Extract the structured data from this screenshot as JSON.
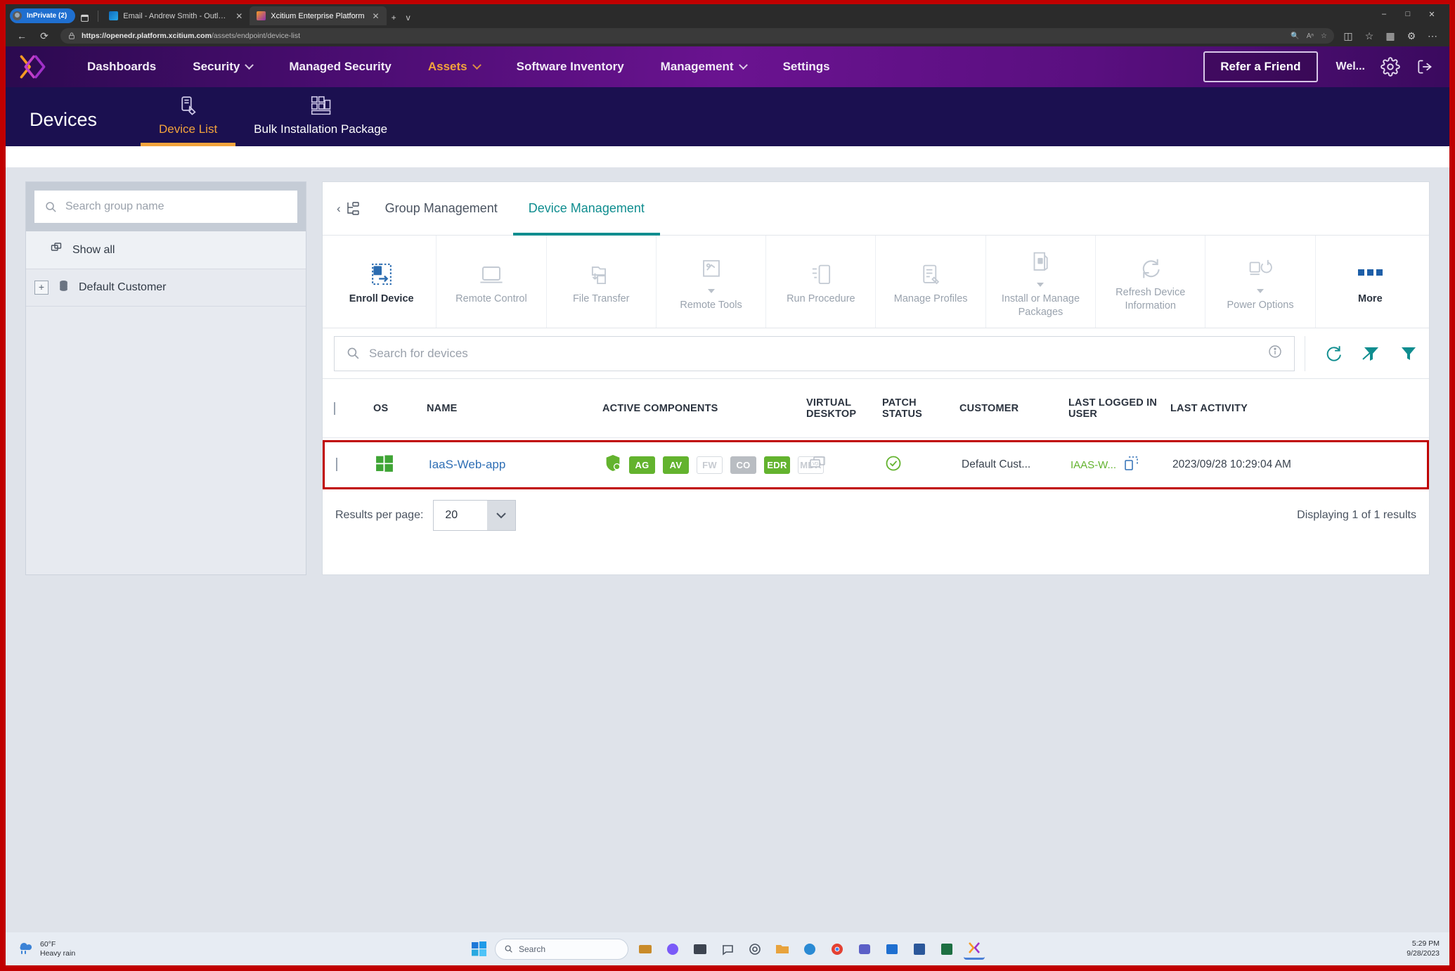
{
  "browser": {
    "tabs": [
      {
        "label": "InPrivate (2)",
        "icon": "inprivate-icon",
        "active": false
      },
      {
        "label": "Email - Andrew Smith - Outlook",
        "icon": "outlook-favicon",
        "active": false
      },
      {
        "label": "Xcitium Enterprise Platform",
        "icon": "xcitium-favicon",
        "active": true
      }
    ],
    "new_tab_label": "+",
    "tab_list_label": "v",
    "window_controls": {
      "minimize": "–",
      "maximize": "□",
      "close": "✕"
    },
    "back_label": "←",
    "refresh_label": "⟳",
    "url_bold": "https://openedr.platform.xcitium.com",
    "url_rest": "/assets/endpoint/device-list",
    "omni_icons": [
      "zoom-icon",
      "read-aloud-icon",
      "favorite-icon"
    ],
    "addr_right_icons": [
      "split-screen-icon",
      "favorites-icon",
      "collections-icon",
      "browser-essentials-icon",
      "settings-more-icon"
    ]
  },
  "appnav": {
    "logo_name": "xcitium-logo",
    "links": [
      {
        "label": "Dashboards",
        "caret": false,
        "active": false
      },
      {
        "label": "Security",
        "caret": true,
        "active": false
      },
      {
        "label": "Managed Security",
        "caret": false,
        "active": false
      },
      {
        "label": "Assets",
        "caret": true,
        "active": true
      },
      {
        "label": "Software Inventory",
        "caret": false,
        "active": false
      },
      {
        "label": "Management",
        "caret": true,
        "active": false
      },
      {
        "label": "Settings",
        "caret": false,
        "active": false
      }
    ],
    "refer_label": "Refer a Friend",
    "welcome_label": "Wel...",
    "gear_icon": "gear-icon",
    "logout_icon": "logout-icon"
  },
  "pagehead": {
    "title": "Devices",
    "tabs": [
      {
        "label": "Device List",
        "icon": "device-list-icon",
        "active": true
      },
      {
        "label": "Bulk Installation Package",
        "icon": "bulk-package-icon",
        "active": false
      }
    ]
  },
  "grouppanel": {
    "search_placeholder": "Search group name",
    "search_value": "",
    "items": [
      {
        "label": "Show all",
        "icon": "show-all-icon",
        "expandable": false
      },
      {
        "label": "Default Customer",
        "icon": "customer-icon",
        "expandable": true,
        "expand_label": "+"
      }
    ]
  },
  "mainpanel": {
    "tabs": [
      {
        "label": "Group Management",
        "active": false
      },
      {
        "label": "Device Management",
        "active": true
      }
    ],
    "collapse_icon": "collapse-tree-icon",
    "toolbar": [
      {
        "label": "Enroll Device",
        "icon": "enroll-device-icon",
        "enabled": true,
        "caret": false
      },
      {
        "label": "Remote Control",
        "icon": "remote-control-icon",
        "enabled": false,
        "caret": false
      },
      {
        "label": "File Transfer",
        "icon": "file-transfer-icon",
        "enabled": false,
        "caret": false
      },
      {
        "label": "Remote Tools",
        "icon": "remote-tools-icon",
        "enabled": false,
        "caret": true
      },
      {
        "label": "Run Procedure",
        "icon": "run-procedure-icon",
        "enabled": false,
        "caret": false
      },
      {
        "label": "Manage Profiles",
        "icon": "manage-profiles-icon",
        "enabled": false,
        "caret": false
      },
      {
        "label": "Install or Manage Packages",
        "icon": "install-packages-icon",
        "enabled": false,
        "caret": true
      },
      {
        "label": "Refresh Device Information",
        "icon": "refresh-device-icon",
        "enabled": false,
        "caret": false
      },
      {
        "label": "Power Options",
        "icon": "power-options-icon",
        "enabled": false,
        "caret": true
      },
      {
        "label": "More",
        "icon": "more-dots-icon",
        "enabled": true,
        "caret": false
      }
    ],
    "search": {
      "placeholder": "Search for devices",
      "value": "",
      "info_icon": "info-icon",
      "actions": [
        "refresh-icon",
        "clear-filter-icon",
        "filter-icon"
      ]
    },
    "table": {
      "columns": [
        "OS",
        "NAME",
        "ACTIVE COMPONENTS",
        "VIRTUAL DESKTOP",
        "PATCH STATUS",
        "CUSTOMER",
        "LAST LOGGED IN USER",
        "LAST ACTIVITY"
      ],
      "rows": [
        {
          "checked": false,
          "os": "windows-icon",
          "name": "IaaS-Web-app",
          "shield_icon": "shield-icon",
          "components": [
            {
              "code": "AG",
              "state": "green"
            },
            {
              "code": "AV",
              "state": "green"
            },
            {
              "code": "FW",
              "state": "outline"
            },
            {
              "code": "CO",
              "state": "gray"
            },
            {
              "code": "EDR",
              "state": "green"
            },
            {
              "code": "MDR",
              "state": "outline"
            }
          ],
          "virtual_desktop": "vd-icon",
          "patch_status": "patch-ok-icon",
          "customer": "Default Cust...",
          "last_user": "IAAS-W...",
          "last_user_icon": "device-link-icon",
          "last_activity": "2023/09/28 10:29:04 AM"
        }
      ]
    },
    "footer": {
      "results_per_page_label": "Results per page:",
      "results_per_page_value": "20",
      "displaying": "Displaying 1 of 1 results"
    }
  },
  "taskbar": {
    "weather_temp": "60°F",
    "weather_desc": "Heavy rain",
    "weather_icon": "rain-icon",
    "start_icon": "windows-start-icon",
    "search_placeholder": "Search",
    "search_icon": "search-icon",
    "apps": [
      "widgets-icon",
      "copilot-icon",
      "file-explorer-icon",
      "chat-icon",
      "settings-icon",
      "folder-icon",
      "edge-icon",
      "chrome-icon",
      "teams-icon",
      "store-icon",
      "word-icon",
      "excel-icon",
      "xcitium-app-icon"
    ],
    "clock_time": "5:29 PM",
    "clock_date": "9/28/2023"
  },
  "colors": {
    "accent_orange": "#f2a33c",
    "teal": "#0f8d8f",
    "green": "#63b32e",
    "brand_purple": "#6a1390",
    "highlight_red": "#c00000"
  }
}
